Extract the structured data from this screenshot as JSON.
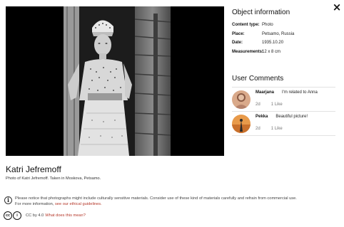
{
  "close": {
    "icon": "close-icon",
    "label": "×"
  },
  "photo": {
    "alt": "Black and white portrait of a woman in traditional costume standing in a wooden doorway"
  },
  "info": {
    "title": "Object information",
    "rows": [
      {
        "key": "Content type:",
        "value": "Photo"
      },
      {
        "key": "Place:",
        "value": "Petsamo, Russia"
      },
      {
        "key": "Date:",
        "value": "1935.10.20"
      },
      {
        "key": "Measurements:",
        "value": "12 x 8 cm"
      }
    ]
  },
  "comments": {
    "title": "User Comments",
    "items": [
      {
        "user": "Maarjana",
        "text": "I'm related to Anna",
        "time": "2d",
        "likes": "1 Like"
      },
      {
        "user": "Pekka",
        "text": "Beautiful picture!",
        "time": "2d",
        "likes": "1 Like"
      }
    ]
  },
  "caption": {
    "title": "Katri Jefremoff",
    "subtitle": "Photo of Katri Jefremoff. Taken in Moskova, Petsamo."
  },
  "notice": {
    "icon": "info-icon",
    "icon_glyph": "i",
    "line1": "Please notice that photographs might include culturally sensitive materials. Consider use of these kind of materials carefully and refrain from commercial use.",
    "line2_prefix": "For more information, ",
    "line2_link": "see our ethical guidelines."
  },
  "license": {
    "icons": [
      "cc-icon",
      "by-icon"
    ],
    "cc_glyph": "cc",
    "by_glyph": "i",
    "text": "CC by 4.0",
    "link": "What does this mean?"
  }
}
